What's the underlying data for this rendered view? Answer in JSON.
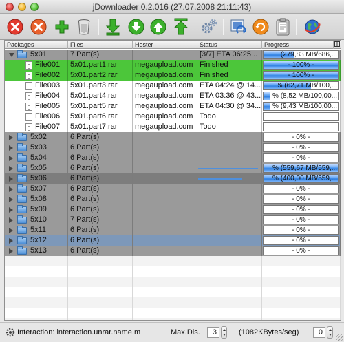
{
  "window": {
    "title": "jDownloader 0.2.016 (27.07.2008 21:11:43)"
  },
  "toolbar": {
    "buttons": [
      {
        "icon": "stop-icon",
        "name": "stop-button"
      },
      {
        "icon": "remove-icon",
        "name": "remove-button"
      },
      {
        "icon": "add-icon",
        "name": "add-button"
      },
      {
        "icon": "trash-icon",
        "name": "clear-button"
      },
      {
        "icon": "download-icon",
        "name": "start-download-button"
      },
      {
        "icon": "move-down-icon",
        "name": "move-down-button"
      },
      {
        "icon": "move-up-icon",
        "name": "move-up-button"
      },
      {
        "icon": "move-top-icon",
        "name": "move-top-button"
      },
      {
        "icon": "settings-icon",
        "name": "settings-button"
      },
      {
        "icon": "reconnect-icon",
        "name": "reconnect-button"
      },
      {
        "icon": "update-icon",
        "name": "update-button"
      },
      {
        "icon": "clipboard-icon",
        "name": "clipboard-button"
      },
      {
        "icon": "globe-icon",
        "name": "web-update-button"
      }
    ]
  },
  "table": {
    "columns": [
      "Packages",
      "Files",
      "Hoster",
      "Status",
      "Progress"
    ],
    "rows": [
      {
        "kind": "pkg",
        "expanded": true,
        "name": "5x01",
        "files": "7 Part(s)",
        "hoster": "",
        "status": "[3/7] ETA 06:25...",
        "progress": "(279,83 MB/686,...",
        "progress_fraction": 0.41,
        "align": "right",
        "style": ""
      },
      {
        "kind": "file",
        "name": "File001",
        "files": "5x01.part1.rar",
        "hoster": "megaupload.com",
        "status": "Finished",
        "progress": "- 100% -",
        "progress_fraction": 1.0,
        "align": "center",
        "style": "done"
      },
      {
        "kind": "file",
        "name": "File002",
        "files": "5x01.part2.rar",
        "hoster": "megaupload.com",
        "status": "Finished",
        "progress": "- 100% -",
        "progress_fraction": 1.0,
        "align": "center",
        "style": "done"
      },
      {
        "kind": "file",
        "name": "File003",
        "files": "5x01.part3.rar",
        "hoster": "megaupload.com",
        "status": "ETA 04:24 @ 14...",
        "progress": "% (62,71 MB/100,...",
        "progress_fraction": 0.63,
        "align": "right",
        "style": ""
      },
      {
        "kind": "file",
        "name": "File004",
        "files": "5x01.part4.rar",
        "hoster": "megaupload.com",
        "status": "ETA 03:36 @ 43...",
        "progress": "% (8,52 MB/100,00...",
        "progress_fraction": 0.09,
        "align": "right",
        "style": ""
      },
      {
        "kind": "file",
        "name": "File005",
        "files": "5x01.part5.rar",
        "hoster": "megaupload.com",
        "status": "ETA 04:30 @ 34...",
        "progress": "% (9,43 MB/100,00...",
        "progress_fraction": 0.09,
        "align": "right",
        "style": ""
      },
      {
        "kind": "file",
        "name": "File006",
        "files": "5x01.part6.rar",
        "hoster": "megaupload.com",
        "status": "Todo",
        "progress": "",
        "progress_fraction": 0,
        "align": "center",
        "style": ""
      },
      {
        "kind": "file",
        "name": "File007",
        "files": "5x01.part7.rar",
        "hoster": "megaupload.com",
        "status": "Todo",
        "progress": "",
        "progress_fraction": 0,
        "align": "center",
        "style": ""
      },
      {
        "kind": "pkg",
        "expanded": false,
        "name": "5x02",
        "files": "6 Part(s)",
        "hoster": "",
        "status": "",
        "progress": "- 0% -",
        "progress_fraction": 0,
        "align": "center",
        "style": ""
      },
      {
        "kind": "pkg",
        "expanded": false,
        "name": "5x03",
        "files": "6 Part(s)",
        "hoster": "",
        "status": "",
        "progress": "- 0% -",
        "progress_fraction": 0,
        "align": "center",
        "style": ""
      },
      {
        "kind": "pkg",
        "expanded": false,
        "name": "5x04",
        "files": "6 Part(s)",
        "hoster": "",
        "status": "",
        "progress": "- 0% -",
        "progress_fraction": 0,
        "align": "center",
        "style": ""
      },
      {
        "kind": "pkg",
        "expanded": false,
        "name": "5x05",
        "files": "6 Part(s)",
        "hoster": "",
        "status": "",
        "progress": "% (559,67 MB/559,...",
        "progress_fraction": 1.0,
        "align": "right",
        "style": "",
        "status_line": 0.95
      },
      {
        "kind": "pkg",
        "expanded": false,
        "name": "5x06",
        "files": "6 Part(s)",
        "hoster": "",
        "status": "",
        "progress": "% (400,00 MB/559,...",
        "progress_fraction": 1.0,
        "align": "right",
        "style": "dark",
        "status_line": 0.7
      },
      {
        "kind": "pkg",
        "expanded": false,
        "name": "5x07",
        "files": "6 Part(s)",
        "hoster": "",
        "status": "",
        "progress": "- 0% -",
        "progress_fraction": 0,
        "align": "center",
        "style": ""
      },
      {
        "kind": "pkg",
        "expanded": false,
        "name": "5x08",
        "files": "6 Part(s)",
        "hoster": "",
        "status": "",
        "progress": "- 0% -",
        "progress_fraction": 0,
        "align": "center",
        "style": ""
      },
      {
        "kind": "pkg",
        "expanded": false,
        "name": "5x09",
        "files": "6 Part(s)",
        "hoster": "",
        "status": "",
        "progress": "- 0% -",
        "progress_fraction": 0,
        "align": "center",
        "style": ""
      },
      {
        "kind": "pkg",
        "expanded": false,
        "name": "5x10",
        "files": "7 Part(s)",
        "hoster": "",
        "status": "",
        "progress": "- 0% -",
        "progress_fraction": 0,
        "align": "center",
        "style": ""
      },
      {
        "kind": "pkg",
        "expanded": false,
        "name": "5x11",
        "files": "6 Part(s)",
        "hoster": "",
        "status": "",
        "progress": "- 0% -",
        "progress_fraction": 0,
        "align": "center",
        "style": ""
      },
      {
        "kind": "pkg",
        "expanded": false,
        "name": "5x12",
        "files": "6 Part(s)",
        "hoster": "",
        "status": "",
        "progress": "- 0% -",
        "progress_fraction": 0,
        "align": "center",
        "style": "sel"
      },
      {
        "kind": "pkg",
        "expanded": false,
        "name": "5x13",
        "files": "6 Part(s)",
        "hoster": "",
        "status": "",
        "progress": "- 0% -",
        "progress_fraction": 0,
        "align": "center",
        "style": ""
      }
    ]
  },
  "statusbar": {
    "interaction_label": "Interaction: interaction.unrar.name.m",
    "maxdls_label": "Max.Dls.",
    "maxdls_value": "3",
    "speed_label": "(1082KBytes/seg)",
    "speed_value": "0"
  }
}
